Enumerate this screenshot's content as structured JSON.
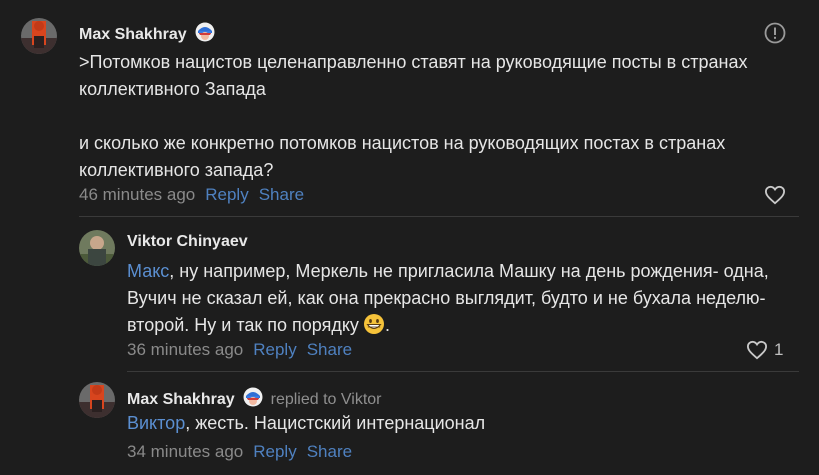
{
  "comments": [
    {
      "author": "Max Shakhray",
      "badge_icon": "captain-shield-badge-icon",
      "paragraphs": [
        ">Потомков нацистов целенаправленно ставят на руководящие посты в странах коллективного Запада",
        "и сколько же конкретно потомков нацистов на руководящих постах в странах коллективного запада?"
      ],
      "time": "46 minutes ago",
      "reply_label": "Reply",
      "share_label": "Share"
    },
    {
      "author": "Viktor Chinyaev",
      "mention": "Макс",
      "text": ", ну например, Меркель не пригласила Машку на день рождения- одна, Вучич не сказал ей, как она прекрасно выглядит, будто и не бухала неделю-второй. Ну и так по порядку",
      "emoji_icon": "grinning-face-emoji-icon",
      "text_end": ".",
      "time": "36 minutes ago",
      "reply_label": "Reply",
      "share_label": "Share",
      "likes": "1"
    },
    {
      "author": "Max Shakhray",
      "badge_icon": "captain-shield-badge-icon",
      "replied_to": "replied to Viktor",
      "mention": "Виктор",
      "text": ", жесть. Нацистский интернационал",
      "time": "34 minutes ago",
      "reply_label": "Reply",
      "share_label": "Share"
    }
  ]
}
